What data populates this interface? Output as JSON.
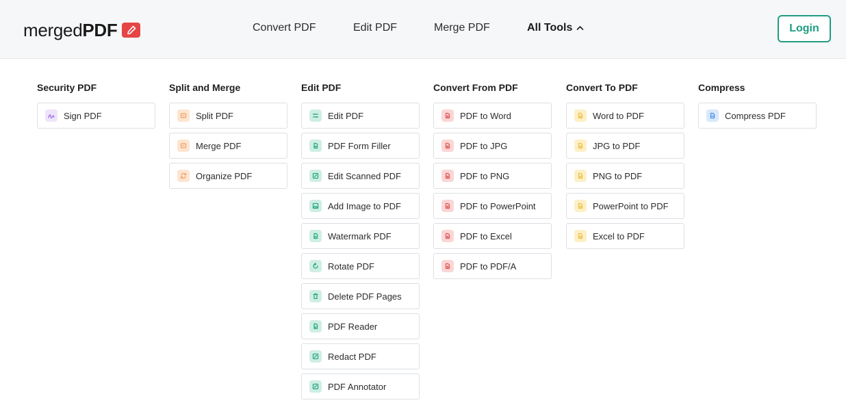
{
  "header": {
    "logo": {
      "light": "merged",
      "bold": "PDF"
    },
    "nav": [
      {
        "label": "Convert PDF"
      },
      {
        "label": "Edit PDF"
      },
      {
        "label": "Merge PDF"
      },
      {
        "label": "All Tools"
      }
    ],
    "login_label": "Login"
  },
  "columns": [
    {
      "title": "Security PDF",
      "icon_color": "#9b6fe0",
      "items": [
        {
          "label": "Sign PDF",
          "icon": "signature-icon"
        }
      ]
    },
    {
      "title": "Split and Merge",
      "icon_color": "#f0a36a",
      "items": [
        {
          "label": "Split PDF",
          "icon": "split-icon"
        },
        {
          "label": "Merge PDF",
          "icon": "merge-icon"
        },
        {
          "label": "Organize PDF",
          "icon": "organize-icon"
        }
      ]
    },
    {
      "title": "Edit PDF",
      "icon_color": "#2aa883",
      "items": [
        {
          "label": "Edit PDF",
          "icon": "sliders-icon"
        },
        {
          "label": "PDF Form Filler",
          "icon": "form-icon"
        },
        {
          "label": "Edit Scanned PDF",
          "icon": "edit-icon"
        },
        {
          "label": "Add Image to PDF",
          "icon": "image-icon"
        },
        {
          "label": "Watermark PDF",
          "icon": "watermark-icon"
        },
        {
          "label": "Rotate PDF",
          "icon": "rotate-icon"
        },
        {
          "label": "Delete PDF Pages",
          "icon": "trash-icon"
        },
        {
          "label": "PDF Reader",
          "icon": "reader-icon"
        },
        {
          "label": "Redact PDF",
          "icon": "redact-icon"
        },
        {
          "label": "PDF Annotator",
          "icon": "annotate-icon"
        }
      ]
    },
    {
      "title": "Convert From PDF",
      "icon_color": "#e25a5a",
      "items": [
        {
          "label": "PDF to Word",
          "icon": "convert-icon"
        },
        {
          "label": "PDF to JPG",
          "icon": "convert-icon"
        },
        {
          "label": "PDF to PNG",
          "icon": "convert-icon"
        },
        {
          "label": "PDF to PowerPoint",
          "icon": "convert-icon"
        },
        {
          "label": "PDF to Excel",
          "icon": "convert-icon"
        },
        {
          "label": "PDF to PDF/A",
          "icon": "convert-icon"
        }
      ]
    },
    {
      "title": "Convert To PDF",
      "icon_color": "#eec14a",
      "items": [
        {
          "label": "Word to PDF",
          "icon": "convert-icon"
        },
        {
          "label": "JPG to PDF",
          "icon": "convert-icon"
        },
        {
          "label": "PNG to PDF",
          "icon": "convert-icon"
        },
        {
          "label": "PowerPoint to PDF",
          "icon": "convert-icon"
        },
        {
          "label": "Excel to PDF",
          "icon": "convert-icon"
        }
      ]
    },
    {
      "title": "Compress",
      "icon_color": "#4a8fe6",
      "items": [
        {
          "label": "Compress PDF",
          "icon": "compress-icon"
        }
      ]
    }
  ],
  "colors": {
    "accent": "#1f9d83",
    "logo_badge": "#e64545"
  }
}
